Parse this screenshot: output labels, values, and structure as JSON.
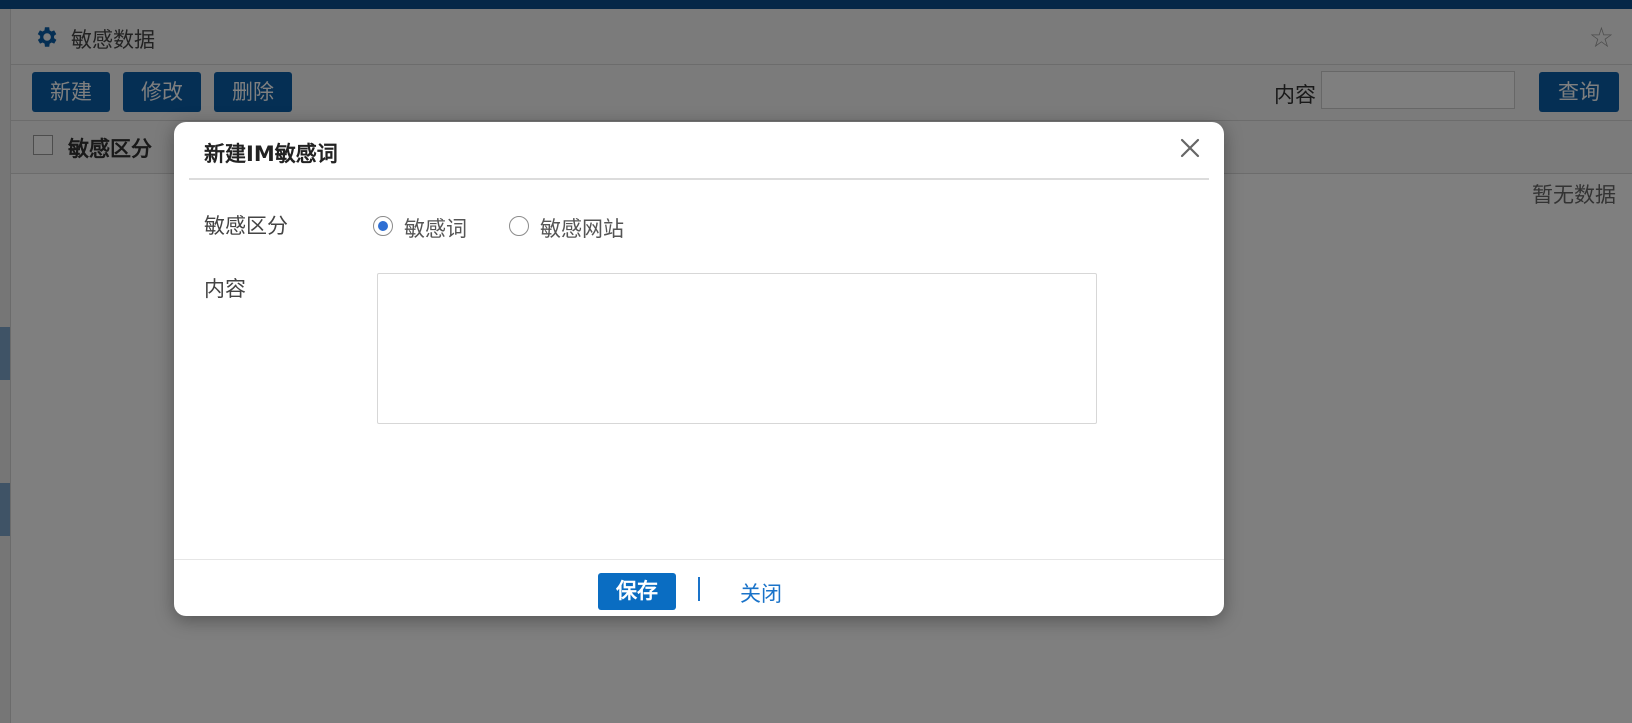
{
  "page": {
    "title": "敏感数据",
    "empty_text": "暂无数据"
  },
  "toolbar": {
    "new_label": "新建",
    "edit_label": "修改",
    "delete_label": "删除",
    "search_label": "内容",
    "search_value": "",
    "query_label": "查询"
  },
  "table": {
    "columns": [
      "敏感区分"
    ]
  },
  "dialog": {
    "title": "新建IM敏感词",
    "category_label": "敏感区分",
    "category_options": [
      {
        "label": "敏感词",
        "checked": true
      },
      {
        "label": "敏感网站",
        "checked": false
      }
    ],
    "content_label": "内容",
    "content_value": "",
    "save_label": "保存",
    "close_label": "关闭"
  },
  "icons": {
    "settings": "gear-icon",
    "favorite": "star-icon",
    "close": "close-icon"
  },
  "colors": {
    "brand": "#0a5fa8",
    "top_bar": "#0a4f8f",
    "link": "#1a73c9",
    "radio_selected": "#2f6fd3"
  }
}
